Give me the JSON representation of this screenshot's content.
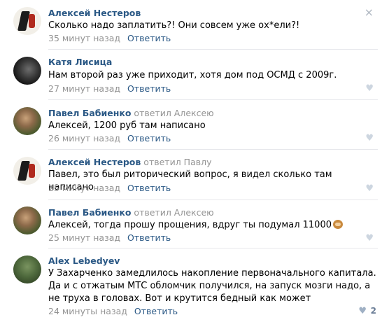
{
  "comments": [
    {
      "author": "Алексей Нестеров",
      "replied": "",
      "reply_to": "",
      "text": "Сколько надо заплатить?! Они совсем уже ох*ели?!",
      "time": "35 минут назад",
      "reply_label": "Ответить",
      "close_icon": "×",
      "avatar": "avatar-nesterov"
    },
    {
      "author": "Катя Лисица",
      "replied": "",
      "reply_to": "",
      "text": "Нам второй раз уже приходит, хотя дом под ОСМД с 2009г.",
      "time": "27 минут назад",
      "reply_label": "Ответить",
      "like_icon": "♥"
    },
    {
      "author": "Павел Бабиенко",
      "replied": "ответил",
      "reply_to": "Алексею",
      "text": "Алексей, 1200 руб там написано",
      "time": "26 минут назад",
      "reply_label": "Ответить",
      "like_icon": "♥"
    },
    {
      "author": "Алексей Нестеров",
      "replied": "ответил",
      "reply_to": "Павлу",
      "text": "Павел, это был риторический вопрос, я видел сколько там написано",
      "time": "25 минут назад",
      "reply_label": "Ответить",
      "like_icon": "♥"
    },
    {
      "author": "Павел Бабиенко",
      "replied": "ответил",
      "reply_to": "Алексею",
      "text": "Алексей, тогда прошу прощения, вдруг ты подумал 11000",
      "time": "25 минут назад",
      "reply_label": "Ответить",
      "like_icon": "♥"
    },
    {
      "author": "Alex Lebedyev",
      "replied": "",
      "reply_to": "",
      "text": "У Захарченко замедлилось накопление первоначального капитала. Да и с отжатым МТС обломчик получился, на запуск мозги надо, а не труха в головах. Вот и крутится бедный как может",
      "time": "24 минуты назад",
      "reply_label": "Ответить",
      "like_icon": "♥",
      "like_count": "2"
    }
  ],
  "colors": {
    "author": "#2a5885",
    "meta": "#939393",
    "separator": "#e7e8ec"
  }
}
